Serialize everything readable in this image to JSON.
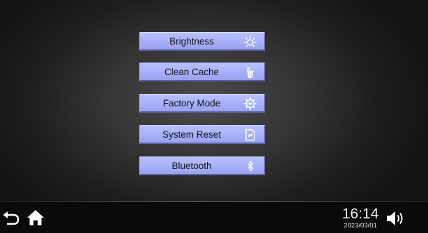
{
  "menu": {
    "items": [
      {
        "label": "Brightness",
        "icon": "brightness-icon"
      },
      {
        "label": "Clean Cache",
        "icon": "trash-icon"
      },
      {
        "label": "Factory Mode",
        "icon": "factory-gear-icon"
      },
      {
        "label": "System Reset",
        "icon": "reset-icon"
      },
      {
        "label": "Bluetooth",
        "icon": "bluetooth-icon"
      }
    ]
  },
  "status_bar": {
    "time": "16:14",
    "date": "2023/03/01",
    "back_icon": "back-arrow-icon",
    "home_icon": "home-icon",
    "volume_icon": "volume-icon"
  },
  "colors": {
    "button_fill": "#a9b1f9",
    "background": "#1e1e1e",
    "icon_white": "#ffffff"
  }
}
